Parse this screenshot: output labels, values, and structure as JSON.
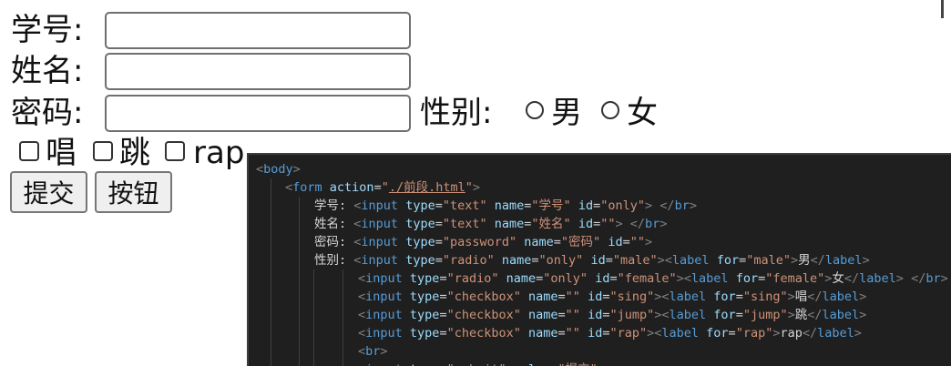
{
  "form": {
    "student_id_label": "学号:",
    "name_label": "姓名:",
    "password_label": "密码:",
    "gender_label": "性别:",
    "gender_options": [
      "男",
      "女"
    ],
    "hobbies": [
      "唱",
      "跳",
      "rap"
    ],
    "submit_label": "提交",
    "button_label": "按钮"
  },
  "editor": {
    "lines": [
      {
        "indent": 0,
        "parts": [
          {
            "c": "t-br",
            "t": "<"
          },
          {
            "c": "t-tag",
            "t": "body"
          },
          {
            "c": "t-br",
            "t": ">"
          }
        ]
      },
      {
        "indent": 1,
        "parts": [
          {
            "c": "t-br",
            "t": "<"
          },
          {
            "c": "t-tag",
            "t": "form"
          },
          {
            "c": "t-txt",
            "t": " "
          },
          {
            "c": "t-attr",
            "t": "action"
          },
          {
            "c": "t-eq",
            "t": "="
          },
          {
            "c": "t-str",
            "t": "\""
          },
          {
            "c": "t-link",
            "t": "./前段.html"
          },
          {
            "c": "t-str",
            "t": "\""
          },
          {
            "c": "t-br",
            "t": ">"
          }
        ]
      },
      {
        "indent": 2,
        "parts": [
          {
            "c": "t-txt",
            "t": "学号: "
          },
          {
            "c": "t-br",
            "t": "<"
          },
          {
            "c": "t-tag",
            "t": "input"
          },
          {
            "c": "t-txt",
            "t": " "
          },
          {
            "c": "t-attr",
            "t": "type"
          },
          {
            "c": "t-eq",
            "t": "="
          },
          {
            "c": "t-str",
            "t": "\"text\""
          },
          {
            "c": "t-txt",
            "t": " "
          },
          {
            "c": "t-attr",
            "t": "name"
          },
          {
            "c": "t-eq",
            "t": "="
          },
          {
            "c": "t-str",
            "t": "\"学号\""
          },
          {
            "c": "t-txt",
            "t": " "
          },
          {
            "c": "t-attr",
            "t": "id"
          },
          {
            "c": "t-eq",
            "t": "="
          },
          {
            "c": "t-str",
            "t": "\"only\""
          },
          {
            "c": "t-br",
            "t": ">"
          },
          {
            "c": "t-txt",
            "t": " "
          },
          {
            "c": "t-br",
            "t": "</"
          },
          {
            "c": "t-tag",
            "t": "br"
          },
          {
            "c": "t-br",
            "t": ">"
          }
        ]
      },
      {
        "indent": 2,
        "parts": [
          {
            "c": "t-txt",
            "t": "姓名: "
          },
          {
            "c": "t-br",
            "t": "<"
          },
          {
            "c": "t-tag",
            "t": "input"
          },
          {
            "c": "t-txt",
            "t": " "
          },
          {
            "c": "t-attr",
            "t": "type"
          },
          {
            "c": "t-eq",
            "t": "="
          },
          {
            "c": "t-str",
            "t": "\"text\""
          },
          {
            "c": "t-txt",
            "t": " "
          },
          {
            "c": "t-attr",
            "t": "name"
          },
          {
            "c": "t-eq",
            "t": "="
          },
          {
            "c": "t-str",
            "t": "\"姓名\""
          },
          {
            "c": "t-txt",
            "t": " "
          },
          {
            "c": "t-attr",
            "t": "id"
          },
          {
            "c": "t-eq",
            "t": "="
          },
          {
            "c": "t-str",
            "t": "\"\""
          },
          {
            "c": "t-br",
            "t": ">"
          },
          {
            "c": "t-txt",
            "t": " "
          },
          {
            "c": "t-br",
            "t": "</"
          },
          {
            "c": "t-tag",
            "t": "br"
          },
          {
            "c": "t-br",
            "t": ">"
          }
        ]
      },
      {
        "indent": 2,
        "parts": [
          {
            "c": "t-txt",
            "t": "密码: "
          },
          {
            "c": "t-br",
            "t": "<"
          },
          {
            "c": "t-tag",
            "t": "input"
          },
          {
            "c": "t-txt",
            "t": " "
          },
          {
            "c": "t-attr",
            "t": "type"
          },
          {
            "c": "t-eq",
            "t": "="
          },
          {
            "c": "t-str",
            "t": "\"password\""
          },
          {
            "c": "t-txt",
            "t": " "
          },
          {
            "c": "t-attr",
            "t": "name"
          },
          {
            "c": "t-eq",
            "t": "="
          },
          {
            "c": "t-str",
            "t": "\"密码\""
          },
          {
            "c": "t-txt",
            "t": " "
          },
          {
            "c": "t-attr",
            "t": "id"
          },
          {
            "c": "t-eq",
            "t": "="
          },
          {
            "c": "t-str",
            "t": "\"\""
          },
          {
            "c": "t-br",
            "t": ">"
          }
        ]
      },
      {
        "indent": 2,
        "parts": [
          {
            "c": "t-txt",
            "t": "性别: "
          },
          {
            "c": "t-br",
            "t": "<"
          },
          {
            "c": "t-tag",
            "t": "input"
          },
          {
            "c": "t-txt",
            "t": " "
          },
          {
            "c": "t-attr",
            "t": "type"
          },
          {
            "c": "t-eq",
            "t": "="
          },
          {
            "c": "t-str",
            "t": "\"radio\""
          },
          {
            "c": "t-txt",
            "t": " "
          },
          {
            "c": "t-attr",
            "t": "name"
          },
          {
            "c": "t-eq",
            "t": "="
          },
          {
            "c": "t-str",
            "t": "\"only\""
          },
          {
            "c": "t-txt",
            "t": " "
          },
          {
            "c": "t-attr",
            "t": "id"
          },
          {
            "c": "t-eq",
            "t": "="
          },
          {
            "c": "t-str",
            "t": "\"male\""
          },
          {
            "c": "t-br",
            "t": "><"
          },
          {
            "c": "t-tag",
            "t": "label"
          },
          {
            "c": "t-txt",
            "t": " "
          },
          {
            "c": "t-attr",
            "t": "for"
          },
          {
            "c": "t-eq",
            "t": "="
          },
          {
            "c": "t-str",
            "t": "\"male\""
          },
          {
            "c": "t-br",
            "t": ">"
          },
          {
            "c": "t-txt",
            "t": "男"
          },
          {
            "c": "t-br",
            "t": "</"
          },
          {
            "c": "t-tag",
            "t": "label"
          },
          {
            "c": "t-br",
            "t": ">"
          }
        ]
      },
      {
        "indent": 3,
        "parts": [
          {
            "c": "t-br",
            "t": "<"
          },
          {
            "c": "t-tag",
            "t": "input"
          },
          {
            "c": "t-txt",
            "t": " "
          },
          {
            "c": "t-attr",
            "t": "type"
          },
          {
            "c": "t-eq",
            "t": "="
          },
          {
            "c": "t-str",
            "t": "\"radio\""
          },
          {
            "c": "t-txt",
            "t": " "
          },
          {
            "c": "t-attr",
            "t": "name"
          },
          {
            "c": "t-eq",
            "t": "="
          },
          {
            "c": "t-str",
            "t": "\"only\""
          },
          {
            "c": "t-txt",
            "t": " "
          },
          {
            "c": "t-attr",
            "t": "id"
          },
          {
            "c": "t-eq",
            "t": "="
          },
          {
            "c": "t-str",
            "t": "\"female\""
          },
          {
            "c": "t-br",
            "t": "><"
          },
          {
            "c": "t-tag",
            "t": "label"
          },
          {
            "c": "t-txt",
            "t": " "
          },
          {
            "c": "t-attr",
            "t": "for"
          },
          {
            "c": "t-eq",
            "t": "="
          },
          {
            "c": "t-str",
            "t": "\"female\""
          },
          {
            "c": "t-br",
            "t": ">"
          },
          {
            "c": "t-txt",
            "t": "女"
          },
          {
            "c": "t-br",
            "t": "</"
          },
          {
            "c": "t-tag",
            "t": "label"
          },
          {
            "c": "t-br",
            "t": ">"
          },
          {
            "c": "t-txt",
            "t": " "
          },
          {
            "c": "t-br",
            "t": "</"
          },
          {
            "c": "t-tag",
            "t": "br"
          },
          {
            "c": "t-br",
            "t": ">"
          }
        ]
      },
      {
        "indent": 3,
        "parts": [
          {
            "c": "t-br",
            "t": "<"
          },
          {
            "c": "t-tag",
            "t": "input"
          },
          {
            "c": "t-txt",
            "t": " "
          },
          {
            "c": "t-attr",
            "t": "type"
          },
          {
            "c": "t-eq",
            "t": "="
          },
          {
            "c": "t-str",
            "t": "\"checkbox\""
          },
          {
            "c": "t-txt",
            "t": " "
          },
          {
            "c": "t-attr",
            "t": "name"
          },
          {
            "c": "t-eq",
            "t": "="
          },
          {
            "c": "t-str",
            "t": "\"\""
          },
          {
            "c": "t-txt",
            "t": " "
          },
          {
            "c": "t-attr",
            "t": "id"
          },
          {
            "c": "t-eq",
            "t": "="
          },
          {
            "c": "t-str",
            "t": "\"sing\""
          },
          {
            "c": "t-br",
            "t": "><"
          },
          {
            "c": "t-tag",
            "t": "label"
          },
          {
            "c": "t-txt",
            "t": " "
          },
          {
            "c": "t-attr",
            "t": "for"
          },
          {
            "c": "t-eq",
            "t": "="
          },
          {
            "c": "t-str",
            "t": "\"sing\""
          },
          {
            "c": "t-br",
            "t": ">"
          },
          {
            "c": "t-txt",
            "t": "唱"
          },
          {
            "c": "t-br",
            "t": "</"
          },
          {
            "c": "t-tag",
            "t": "label"
          },
          {
            "c": "t-br",
            "t": ">"
          }
        ]
      },
      {
        "indent": 3,
        "parts": [
          {
            "c": "t-br",
            "t": "<"
          },
          {
            "c": "t-tag",
            "t": "input"
          },
          {
            "c": "t-txt",
            "t": " "
          },
          {
            "c": "t-attr",
            "t": "type"
          },
          {
            "c": "t-eq",
            "t": "="
          },
          {
            "c": "t-str",
            "t": "\"checkbox\""
          },
          {
            "c": "t-txt",
            "t": " "
          },
          {
            "c": "t-attr",
            "t": "name"
          },
          {
            "c": "t-eq",
            "t": "="
          },
          {
            "c": "t-str",
            "t": "\"\""
          },
          {
            "c": "t-txt",
            "t": " "
          },
          {
            "c": "t-attr",
            "t": "id"
          },
          {
            "c": "t-eq",
            "t": "="
          },
          {
            "c": "t-str",
            "t": "\"jump\""
          },
          {
            "c": "t-br",
            "t": "><"
          },
          {
            "c": "t-tag",
            "t": "label"
          },
          {
            "c": "t-txt",
            "t": " "
          },
          {
            "c": "t-attr",
            "t": "for"
          },
          {
            "c": "t-eq",
            "t": "="
          },
          {
            "c": "t-str",
            "t": "\"jump\""
          },
          {
            "c": "t-br",
            "t": ">"
          },
          {
            "c": "t-txt",
            "t": "跳"
          },
          {
            "c": "t-br",
            "t": "</"
          },
          {
            "c": "t-tag",
            "t": "label"
          },
          {
            "c": "t-br",
            "t": ">"
          }
        ]
      },
      {
        "indent": 3,
        "parts": [
          {
            "c": "t-br",
            "t": "<"
          },
          {
            "c": "t-tag",
            "t": "input"
          },
          {
            "c": "t-txt",
            "t": " "
          },
          {
            "c": "t-attr",
            "t": "type"
          },
          {
            "c": "t-eq",
            "t": "="
          },
          {
            "c": "t-str",
            "t": "\"checkbox\""
          },
          {
            "c": "t-txt",
            "t": " "
          },
          {
            "c": "t-attr",
            "t": "name"
          },
          {
            "c": "t-eq",
            "t": "="
          },
          {
            "c": "t-str",
            "t": "\"\""
          },
          {
            "c": "t-txt",
            "t": " "
          },
          {
            "c": "t-attr",
            "t": "id"
          },
          {
            "c": "t-eq",
            "t": "="
          },
          {
            "c": "t-str",
            "t": "\"rap\""
          },
          {
            "c": "t-br",
            "t": "><"
          },
          {
            "c": "t-tag",
            "t": "label"
          },
          {
            "c": "t-txt",
            "t": " "
          },
          {
            "c": "t-attr",
            "t": "for"
          },
          {
            "c": "t-eq",
            "t": "="
          },
          {
            "c": "t-str",
            "t": "\"rap\""
          },
          {
            "c": "t-br",
            "t": ">"
          },
          {
            "c": "t-txt",
            "t": "rap"
          },
          {
            "c": "t-br",
            "t": "</"
          },
          {
            "c": "t-tag",
            "t": "label"
          },
          {
            "c": "t-br",
            "t": ">"
          }
        ]
      },
      {
        "indent": 3,
        "parts": [
          {
            "c": "t-br",
            "t": "<"
          },
          {
            "c": "t-tag",
            "t": "br"
          },
          {
            "c": "t-br",
            "t": ">"
          }
        ]
      },
      {
        "indent": 3,
        "parts": [
          {
            "c": "t-br",
            "t": "<"
          },
          {
            "c": "t-tag",
            "t": "input"
          },
          {
            "c": "t-txt",
            "t": " "
          },
          {
            "c": "t-attr",
            "t": "type"
          },
          {
            "c": "t-eq",
            "t": "="
          },
          {
            "c": "t-str",
            "t": "\"submit\""
          },
          {
            "c": "t-txt",
            "t": " "
          },
          {
            "c": "t-attr",
            "t": "value"
          },
          {
            "c": "t-eq",
            "t": "="
          },
          {
            "c": "t-str",
            "t": "\"提交\""
          }
        ]
      }
    ]
  },
  "colors": {
    "editor_bg": "#1f1f1f",
    "tag": "#569cd6",
    "attr": "#9cdcfe",
    "string": "#ce9178",
    "bracket": "#808080",
    "text": "#d4d4d4"
  }
}
